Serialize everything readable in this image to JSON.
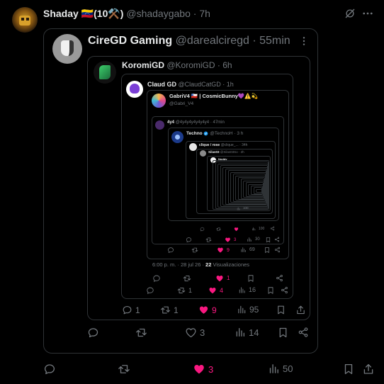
{
  "main": {
    "author": "Shaday",
    "flag": "🇻🇪",
    "badge": "(10⚒️)",
    "handle": "@shadaygabo",
    "time": "7h",
    "actions": {
      "replies": "",
      "reposts": "",
      "likes": "3",
      "views": "50"
    }
  },
  "quote1": {
    "author": "CireGD Gaming",
    "handle": "@darealciregd",
    "time": "55min",
    "actions": {
      "replies": "",
      "reposts": "",
      "likes": "3",
      "views": "14"
    }
  },
  "quote2": {
    "author": "KoromiGD",
    "handle": "@KoromiGD",
    "time": "6h",
    "actions": {
      "replies": "1",
      "reposts": "1",
      "likes": "9",
      "views": "95"
    }
  },
  "quote3": {
    "author": "Claud GD",
    "handle": "@ClaudCatGD",
    "time": "1h",
    "actions": {
      "replies": "",
      "reposts": "1",
      "likes": "4",
      "views": "16"
    }
  },
  "quote4": {
    "author": "GabriV4 🇨🇱 | CosmicBunny💜⚠️💫",
    "handle": "@Gabri_V4",
    "timestamp": "6:00 p. m. · 28 jul 26 ·",
    "views_count": "22",
    "views_label": "Visualizaciones",
    "actions": {
      "replies": "",
      "reposts": "",
      "likes": "1",
      "views": ""
    }
  },
  "quote5": {
    "author": "4y4",
    "handle": "@4y4y4y4y4y4y4",
    "time": "47min",
    "actions": {
      "replies": "",
      "reposts": "",
      "likes": "9",
      "views": "69"
    }
  },
  "quote6": {
    "author": "Techno",
    "handle": "@TechnoH",
    "time": "3 h",
    "actions": {
      "replies": "",
      "reposts": "",
      "likes": "3",
      "views": "30"
    }
  },
  "quote7": {
    "author": "clique / rose",
    "handle": "@clique_...",
    "time": "34h",
    "actions": {
      "replies": "",
      "reposts": "",
      "likes": "",
      "views": "100"
    }
  },
  "quote8": {
    "author": "Silas03",
    "handle": "@Silas03So",
    "time": "2h"
  },
  "quote9": {
    "author": "Noddy",
    "handle": "",
    "time": ""
  },
  "colors": {
    "background": "#000000",
    "border": "#2f3336",
    "text": "#e7e9ea",
    "muted": "#71767b",
    "like": "#f91880",
    "verified": "#1d9bf0"
  }
}
